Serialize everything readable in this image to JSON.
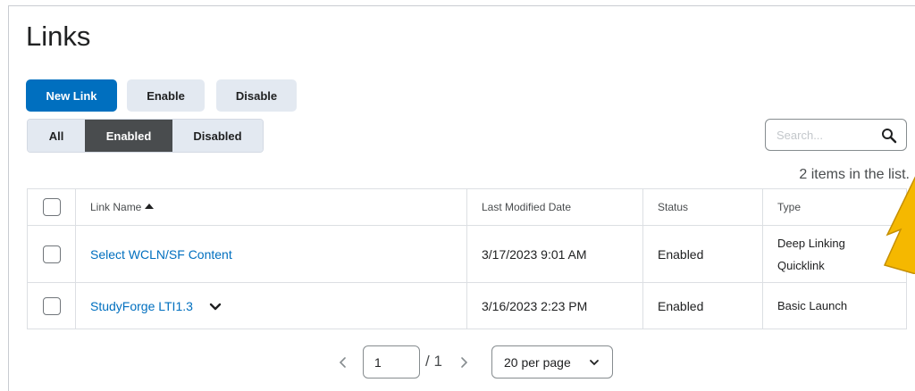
{
  "page": {
    "title": "Links"
  },
  "toolbar": {
    "new_link": "New Link",
    "enable": "Enable",
    "disable": "Disable"
  },
  "filters": {
    "all": "All",
    "enabled": "Enabled",
    "disabled": "Disabled",
    "selected": "Enabled"
  },
  "search": {
    "placeholder": "Search..."
  },
  "list_count": "2 items in the list.",
  "table": {
    "headers": {
      "name": "Link Name",
      "date": "Last Modified Date",
      "status": "Status",
      "type": "Type"
    },
    "rows": [
      {
        "name": "Select WCLN/SF Content",
        "date": "3/17/2023 9:01 AM",
        "status": "Enabled",
        "type_line1": "Deep Linking",
        "type_line2": "Quicklink"
      },
      {
        "name": "StudyForge LTI1.3",
        "date": "3/16/2023 2:23 PM",
        "status": "Enabled",
        "type_line1": "Basic Launch"
      }
    ]
  },
  "pagination": {
    "page": "1",
    "total": "/ 1",
    "per_page": "20 per page"
  },
  "colors": {
    "primary": "#006fbf",
    "annotation_arrow": "#f5b800"
  },
  "icons": {
    "search": "search-icon",
    "sort": "sort-asc-icon",
    "chevron": "chevron-down-icon"
  }
}
